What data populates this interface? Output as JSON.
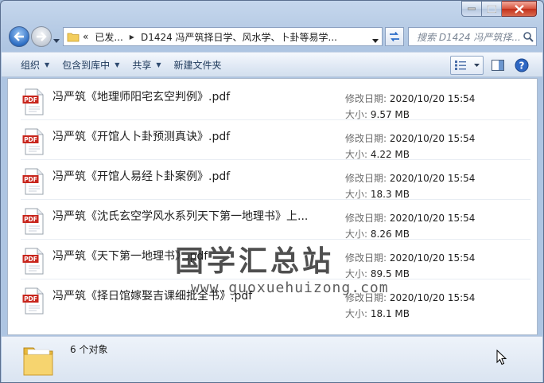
{
  "window": {
    "accent": "#aec5e2"
  },
  "address_bar": {
    "overflow_label": "«",
    "segments": [
      "已发...",
      "D1424 冯严筑择日学、风水学、卜卦等易学..."
    ]
  },
  "search": {
    "placeholder": "搜索 D1424 冯严筑择..."
  },
  "toolbar": {
    "organize": "组织",
    "include_in_library": "包含到库中",
    "share": "共享",
    "new_folder": "新建文件夹"
  },
  "files": [
    {
      "name": "冯严筑《地理师阳宅玄空判例》.pdf",
      "modified_label": "修改日期:",
      "modified": "2020/10/20 15:54",
      "size_label": "大小:",
      "size": "9.57 MB"
    },
    {
      "name": "冯严筑《开馆人卜卦预测真诀》.pdf",
      "modified_label": "修改日期:",
      "modified": "2020/10/20 15:54",
      "size_label": "大小:",
      "size": "4.22 MB"
    },
    {
      "name": "冯严筑《开馆人易经卜卦案例》.pdf",
      "modified_label": "修改日期:",
      "modified": "2020/10/20 15:54",
      "size_label": "大小:",
      "size": "18.3 MB"
    },
    {
      "name": "冯严筑《沈氏玄空学风水系列天下第一地理书》上...",
      "modified_label": "修改日期:",
      "modified": "2020/10/20 15:54",
      "size_label": "大小:",
      "size": "8.26 MB"
    },
    {
      "name": "冯严筑《天下第一地理书》.pdf",
      "modified_label": "修改日期:",
      "modified": "2020/10/20 15:54",
      "size_label": "大小:",
      "size": "89.5 MB"
    },
    {
      "name": "冯严筑《择日馆嫁娶吉课细批全书》.pdf",
      "modified_label": "修改日期:",
      "modified": "2020/10/20 15:54",
      "size_label": "大小:",
      "size": "18.1 MB"
    }
  ],
  "watermark": {
    "title": "国学汇总站",
    "url": "www.guoxuehuizong.com"
  },
  "status": {
    "count": "6 个对象"
  },
  "colors": {
    "pdf_red": "#c8251c",
    "link_blue": "#1e395b"
  }
}
